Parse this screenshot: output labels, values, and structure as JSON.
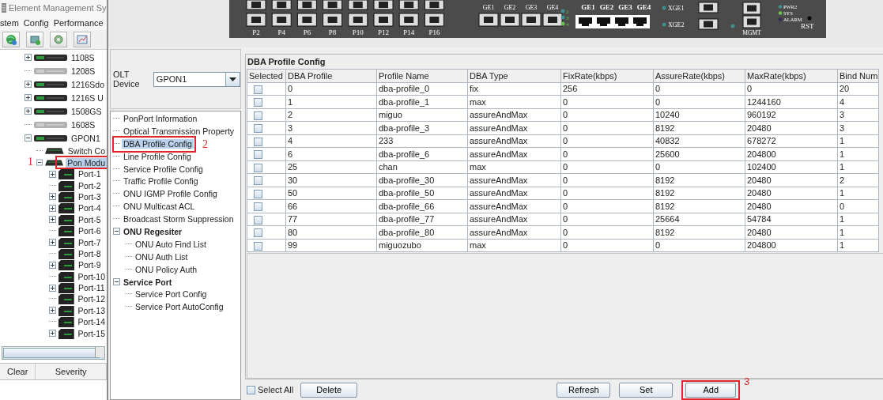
{
  "window": {
    "title": "Element Management Sy"
  },
  "menu": [
    "stem",
    "Config",
    "Performance"
  ],
  "device_tree": [
    {
      "label": "1108S",
      "kind": "collapsed",
      "online": true,
      "selected": false
    },
    {
      "label": "1208S",
      "kind": "leaf",
      "online": false,
      "selected": false
    },
    {
      "label": "1216Sdo",
      "kind": "collapsed",
      "online": true,
      "selected": false
    },
    {
      "label": "1216S U",
      "kind": "collapsed",
      "online": true,
      "selected": false
    },
    {
      "label": "1508GS",
      "kind": "collapsed",
      "online": true,
      "selected": false
    },
    {
      "label": "1608S",
      "kind": "leaf",
      "online": false,
      "selected": false
    },
    {
      "label": "GPON1",
      "kind": "expanded",
      "online": true,
      "selected": false,
      "children": [
        {
          "label": "Switch Co",
          "kind": "leaf",
          "selected": false
        },
        {
          "label": "Pon Modu",
          "kind": "expanded",
          "selected": true,
          "annotation": "1",
          "children": [
            {
              "label": "Port-1",
              "kind": "collapsed",
              "selected": false
            },
            {
              "label": "Port-2",
              "kind": "leaf",
              "selected": false
            },
            {
              "label": "Port-3",
              "kind": "collapsed",
              "selected": false
            },
            {
              "label": "Port-4",
              "kind": "collapsed",
              "selected": false
            },
            {
              "label": "Port-5",
              "kind": "collapsed",
              "selected": false
            },
            {
              "label": "Port-6",
              "kind": "leaf",
              "selected": false
            },
            {
              "label": "Port-7",
              "kind": "collapsed",
              "selected": false
            },
            {
              "label": "Port-8",
              "kind": "leaf",
              "selected": false
            },
            {
              "label": "Port-9",
              "kind": "collapsed",
              "selected": false
            },
            {
              "label": "Port-10",
              "kind": "leaf",
              "selected": false
            },
            {
              "label": "Port-11",
              "kind": "collapsed",
              "selected": false
            },
            {
              "label": "Port-12",
              "kind": "leaf",
              "selected": false
            },
            {
              "label": "Port-13",
              "kind": "collapsed",
              "selected": false
            },
            {
              "label": "Port-14",
              "kind": "leaf",
              "selected": false
            },
            {
              "label": "Port-15",
              "kind": "collapsed",
              "selected": false
            }
          ]
        }
      ]
    }
  ],
  "alarm_table": {
    "columns": [
      "Clear",
      "Severity"
    ]
  },
  "device_panel": {
    "sfp_ports": [
      "P2",
      "P4",
      "P6",
      "P8",
      "P10",
      "P12",
      "P14",
      "P16"
    ],
    "ge_ports": [
      "GE1",
      "GE2",
      "GE3",
      "GE4"
    ],
    "port_leds": [
      {
        "label": "2",
        "color": "#3f8f8f"
      },
      {
        "label": "3",
        "color": "#3f8f8f"
      },
      {
        "label": "4",
        "color": "#6cc24a"
      }
    ],
    "rj45_ports": [
      "GE1",
      "GE2",
      "GE3",
      "GE4"
    ],
    "xge_ports": [
      "XGE1",
      "XGE2"
    ],
    "mgmt": "MGMT",
    "status_leds": [
      {
        "label": "PWR2",
        "color": "#3f8f8f"
      },
      {
        "label": "SYS",
        "color": "#6cc24a"
      },
      {
        "label": "ALARM",
        "color": "#3a2a5a"
      }
    ],
    "reset": "RST"
  },
  "olt_device": {
    "label": "OLT Device",
    "value": "GPON1"
  },
  "function_tree": [
    {
      "label": "PonPort Information",
      "kind": "leaf",
      "selected": false
    },
    {
      "label": "Optical Transmission Property",
      "kind": "leaf",
      "selected": false
    },
    {
      "label": "DBA Profile Config",
      "kind": "leaf",
      "selected": true,
      "annotation": "2"
    },
    {
      "label": "Line Profile Config",
      "kind": "leaf",
      "selected": false
    },
    {
      "label": "Service Profile Config",
      "kind": "leaf",
      "selected": false
    },
    {
      "label": "Traffic Profile Config",
      "kind": "leaf",
      "selected": false
    },
    {
      "label": "ONU IGMP Profile Config",
      "kind": "leaf",
      "selected": false
    },
    {
      "label": "ONU Multicast ACL",
      "kind": "leaf",
      "selected": false
    },
    {
      "label": "Broadcast Storm Suppression",
      "kind": "leaf",
      "selected": false
    },
    {
      "label": "ONU Regesiter",
      "kind": "expanded",
      "selected": false,
      "children": [
        {
          "label": "ONU Auto Find List",
          "kind": "leaf",
          "selected": false
        },
        {
          "label": "ONU Auth List",
          "kind": "leaf",
          "selected": false
        },
        {
          "label": "ONU Policy Auth",
          "kind": "leaf",
          "selected": false
        }
      ]
    },
    {
      "label": "Service Port",
      "kind": "expanded",
      "selected": false,
      "children": [
        {
          "label": "Service Port Config",
          "kind": "leaf",
          "selected": false
        },
        {
          "label": "Service Port AutoConfig",
          "kind": "leaf",
          "selected": false
        }
      ]
    }
  ],
  "dba_profile_config": {
    "title": "DBA Profile Config",
    "selection_header": "Selected",
    "columns": [
      "DBA Profile",
      "Profile Name",
      "DBA Type",
      "FixRate(kbps)",
      "AssureRate(kbps)",
      "MaxRate(kbps)",
      "Bind Num"
    ],
    "rows": [
      {
        "checked": false,
        "cells": [
          "0",
          "dba-profile_0",
          "fix",
          "256",
          "0",
          "0",
          "20"
        ]
      },
      {
        "checked": false,
        "cells": [
          "1",
          "dba-profile_1",
          "max",
          "0",
          "0",
          "1244160",
          "4"
        ]
      },
      {
        "checked": false,
        "cells": [
          "2",
          "miguo",
          "assureAndMax",
          "0",
          "10240",
          "960192",
          "3"
        ]
      },
      {
        "checked": false,
        "cells": [
          "3",
          "dba-profile_3",
          "assureAndMax",
          "0",
          "8192",
          "20480",
          "3"
        ]
      },
      {
        "checked": false,
        "cells": [
          "4",
          "233",
          "assureAndMax",
          "0",
          "40832",
          "678272",
          "1"
        ]
      },
      {
        "checked": false,
        "cells": [
          "6",
          "dba-profile_6",
          "assureAndMax",
          "0",
          "25600",
          "204800",
          "1"
        ]
      },
      {
        "checked": false,
        "cells": [
          "25",
          "chan",
          "max",
          "0",
          "0",
          "102400",
          "1"
        ]
      },
      {
        "checked": false,
        "cells": [
          "30",
          "dba-profile_30",
          "assureAndMax",
          "0",
          "8192",
          "20480",
          "2"
        ]
      },
      {
        "checked": false,
        "cells": [
          "50",
          "dba-profile_50",
          "assureAndMax",
          "0",
          "8192",
          "20480",
          "1"
        ]
      },
      {
        "checked": false,
        "cells": [
          "66",
          "dba-profile_66",
          "assureAndMax",
          "0",
          "8192",
          "20480",
          "0"
        ]
      },
      {
        "checked": false,
        "cells": [
          "77",
          "dba-profile_77",
          "assureAndMax",
          "0",
          "25664",
          "54784",
          "1"
        ]
      },
      {
        "checked": false,
        "cells": [
          "80",
          "dba-profile_80",
          "assureAndMax",
          "0",
          "8192",
          "20480",
          "1"
        ]
      },
      {
        "checked": false,
        "cells": [
          "99",
          "miguozubo",
          "max",
          "0",
          "0",
          "204800",
          "1"
        ]
      }
    ]
  },
  "footer": {
    "select_all": {
      "label": "Select All",
      "checked": false
    },
    "left_buttons": [
      {
        "label": "Delete"
      }
    ],
    "right_buttons": [
      {
        "label": "Refresh"
      },
      {
        "label": "Set"
      },
      {
        "label": "Add",
        "annotation": "3"
      }
    ]
  }
}
